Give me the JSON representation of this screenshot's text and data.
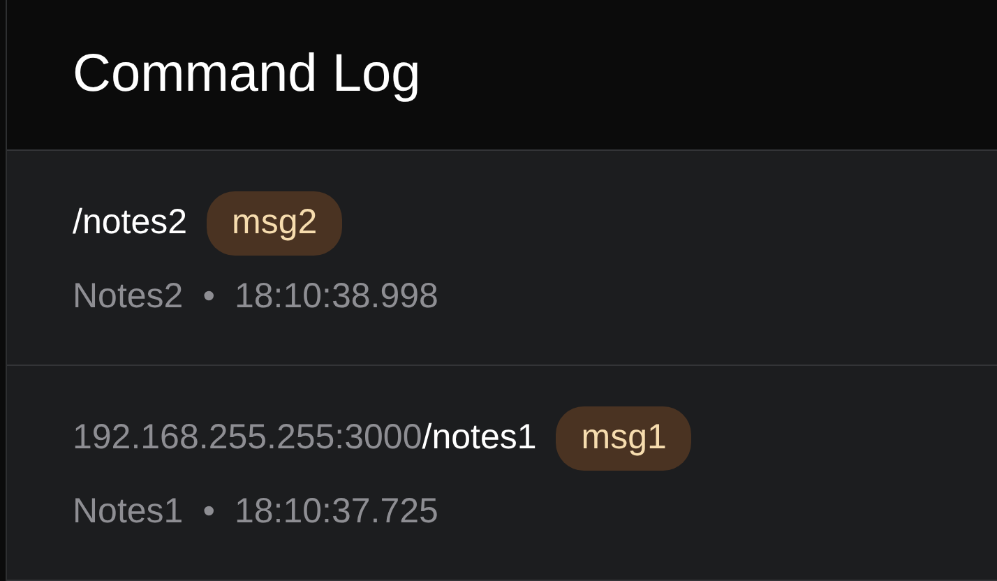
{
  "title": "Command Log",
  "entries": [
    {
      "path": "/notes2",
      "tag": "msg2",
      "source": "Notes2",
      "separator": "•",
      "time": "18:10:38.998"
    },
    {
      "origin": "192.168.255.255:3000",
      "path": "/notes1",
      "tag": "msg1",
      "source": "Notes1",
      "separator": "•",
      "time": "18:10:37.725"
    }
  ]
}
